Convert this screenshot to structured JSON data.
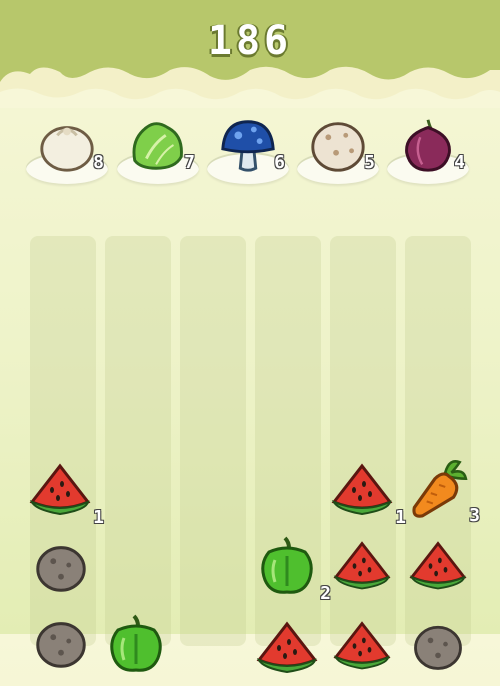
{
  "score": "186",
  "targets": [
    {
      "item": "bun-icon",
      "count": "8"
    },
    {
      "item": "lettuce-icon",
      "count": "7"
    },
    {
      "item": "blue-mushroom-icon",
      "count": "6"
    },
    {
      "item": "potato-icon",
      "count": "5"
    },
    {
      "item": "red-onion-icon",
      "count": "4"
    }
  ],
  "board": {
    "columns": 6,
    "pieces": [
      {
        "column": 1,
        "row": 1,
        "item": "watermelon-icon",
        "count": "1"
      },
      {
        "column": 1,
        "row": 2,
        "item": "potato-icon",
        "count": ""
      },
      {
        "column": 1,
        "row": 3,
        "item": "potato-icon",
        "count": ""
      },
      {
        "column": 2,
        "row": 3,
        "item": "bell-pepper-icon",
        "count": ""
      },
      {
        "column": 4,
        "row": 2,
        "item": "bell-pepper-icon",
        "count": "2"
      },
      {
        "column": 4,
        "row": 3,
        "item": "watermelon-icon",
        "count": ""
      },
      {
        "column": 5,
        "row": 1,
        "item": "watermelon-icon",
        "count": "1"
      },
      {
        "column": 5,
        "row": 2,
        "item": "watermelon-icon",
        "count": ""
      },
      {
        "column": 5,
        "row": 3,
        "item": "watermelon-icon",
        "count": ""
      },
      {
        "column": 6,
        "row": 1,
        "item": "carrot-icon",
        "count": "3"
      },
      {
        "column": 6,
        "row": 2,
        "item": "watermelon-icon",
        "count": ""
      },
      {
        "column": 6,
        "row": 3,
        "item": "potato-icon",
        "count": ""
      }
    ]
  }
}
